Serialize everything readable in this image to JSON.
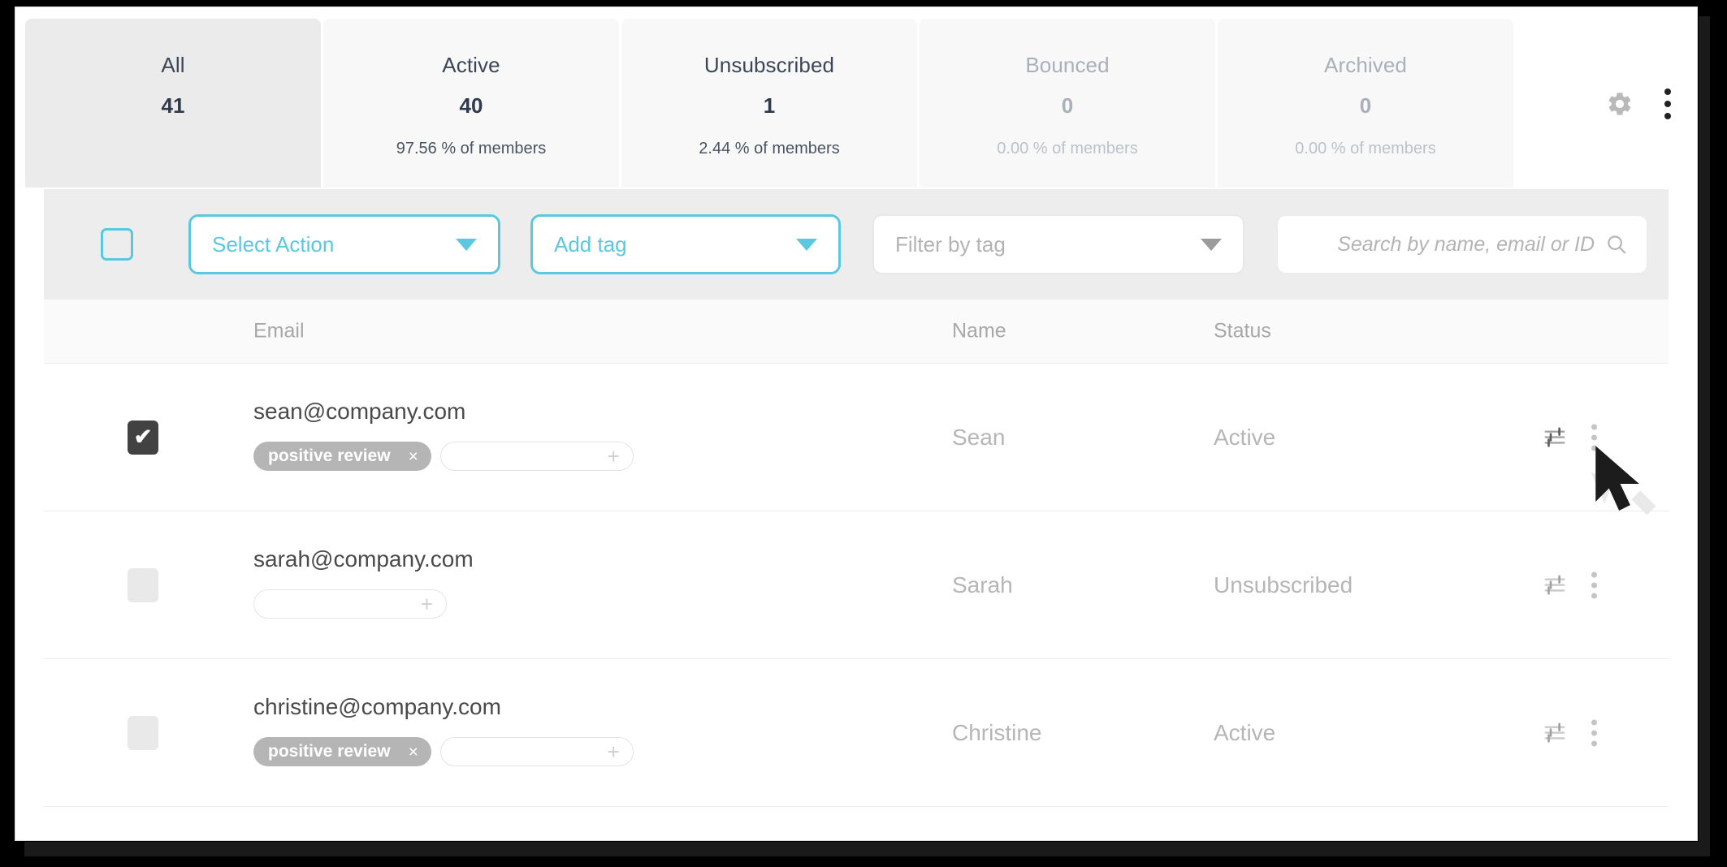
{
  "tabs": [
    {
      "label": "All",
      "count": "41",
      "pct": "",
      "active": true,
      "dim": false
    },
    {
      "label": "Active",
      "count": "40",
      "pct": "97.56 % of members",
      "active": false,
      "dim": false
    },
    {
      "label": "Unsubscribed",
      "count": "1",
      "pct": "2.44 % of members",
      "active": false,
      "dim": false
    },
    {
      "label": "Bounced",
      "count": "0",
      "pct": "0.00 % of members",
      "active": false,
      "dim": true
    },
    {
      "label": "Archived",
      "count": "0",
      "pct": "0.00 % of members",
      "active": false,
      "dim": true
    }
  ],
  "header_icons": {
    "settings": "gear-icon",
    "more": "kebab-menu-icon"
  },
  "toolbar": {
    "select_all_checked": false,
    "select_action_label": "Select Action",
    "add_tag_label": "Add tag",
    "filter_by_tag_label": "Filter by tag",
    "search_value": "",
    "search_placeholder": "Search by name, email or ID",
    "search_icon": "search-icon"
  },
  "table": {
    "columns": {
      "email": "Email",
      "name": "Name",
      "status": "Status"
    },
    "rows": [
      {
        "checked": true,
        "email": "sean@company.com",
        "name": "Sean",
        "status": "Active",
        "tags": [
          "positive review"
        ],
        "tag_remove_glyph": "×",
        "tag_add_glyph": "+"
      },
      {
        "checked": false,
        "email": "sarah@company.com",
        "name": "Sarah",
        "status": "Unsubscribed",
        "tags": [],
        "tag_remove_glyph": "×",
        "tag_add_glyph": "+"
      },
      {
        "checked": false,
        "email": "christine@company.com",
        "name": "Christine",
        "status": "Active",
        "tags": [
          "positive review"
        ],
        "tag_remove_glyph": "×",
        "tag_add_glyph": "+"
      }
    ],
    "row_action_icons": {
      "tune": "tune-sliders-icon",
      "more": "kebab-menu-icon"
    },
    "check_glyph": "✔"
  },
  "colors": {
    "accent_cyan": "#5bc8e0",
    "tab_active_bg": "#ebebeb",
    "tab_bg": "#f8f8f8",
    "toolbar_bg": "#ededed",
    "tag_pill_bg": "#b5b5b5",
    "checkbox_checked_bg": "#424242",
    "muted_text": "#b6b6b6"
  }
}
